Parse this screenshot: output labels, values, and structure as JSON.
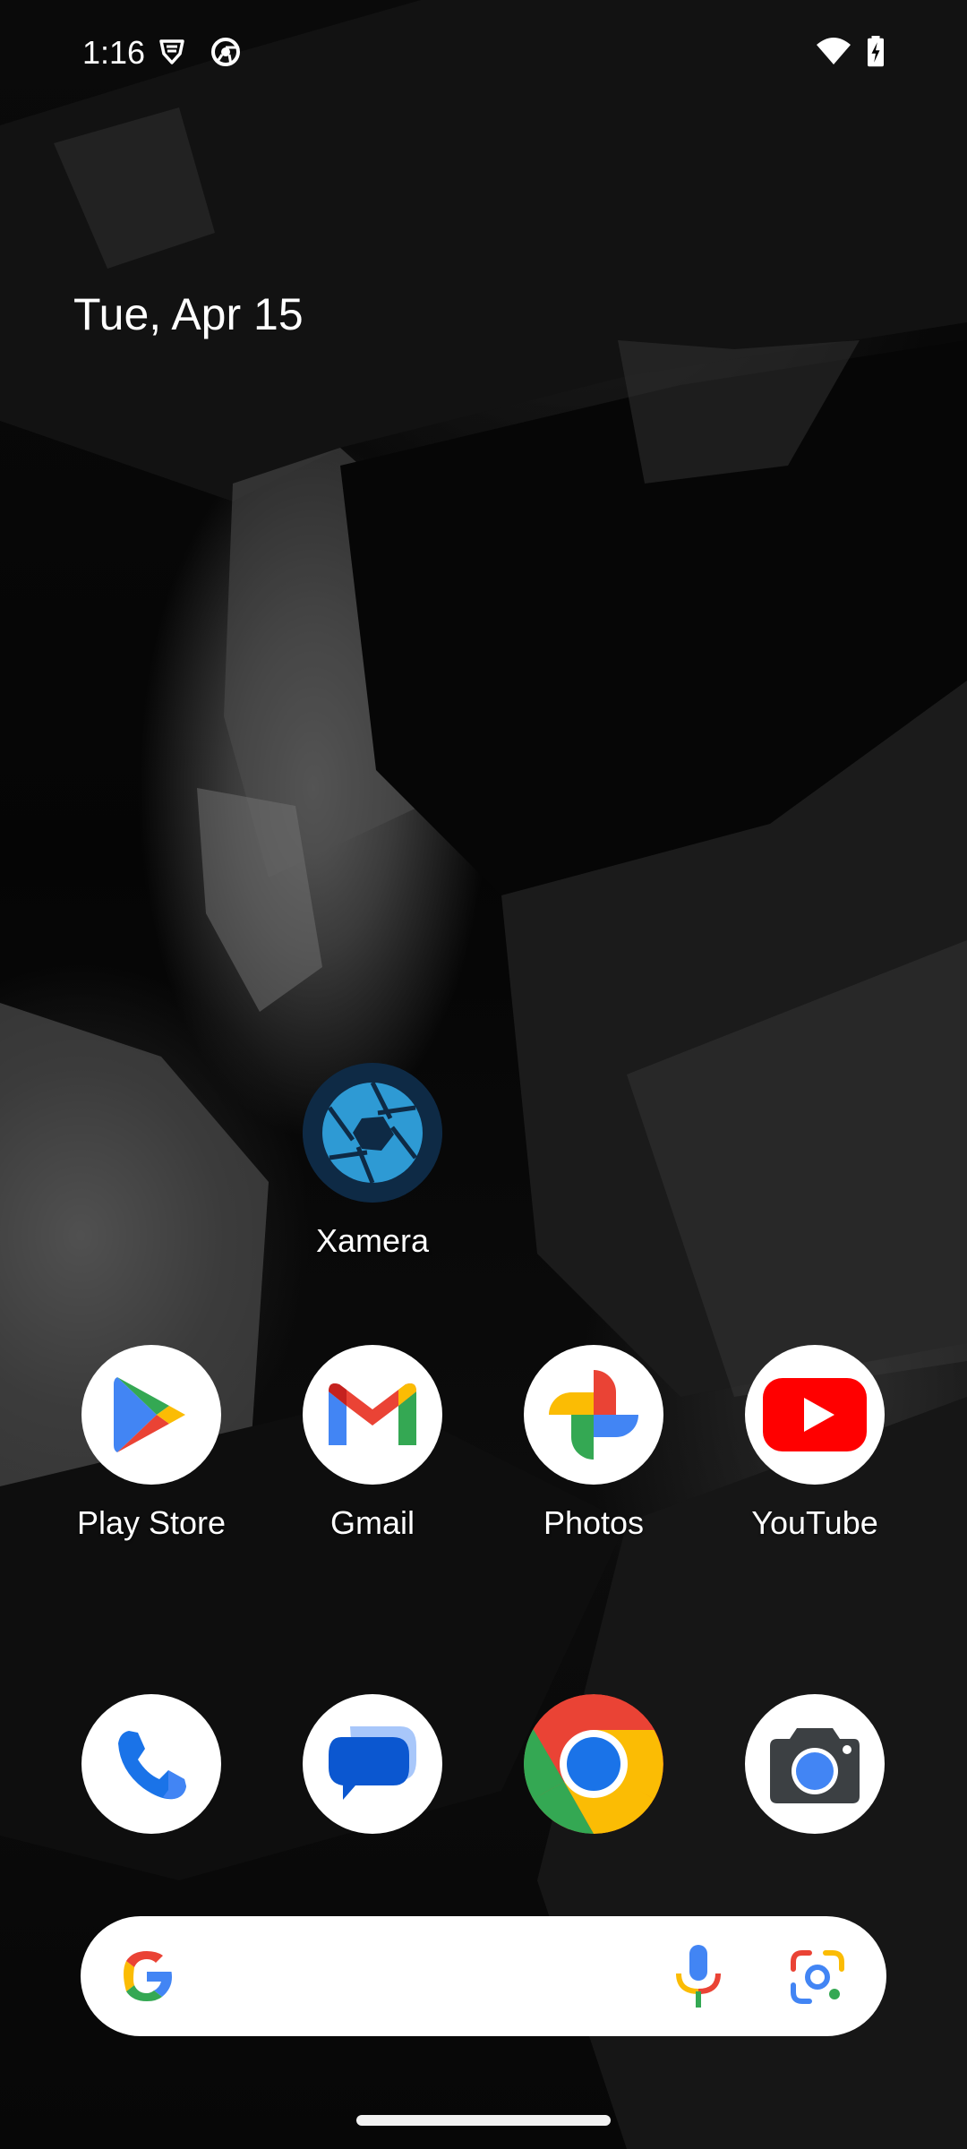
{
  "status_bar": {
    "time": "1:16",
    "icons": [
      "vpn-shield-icon",
      "chrome-notification-icon",
      "wifi-icon",
      "battery-charging-icon"
    ]
  },
  "date_widget": {
    "date": "Tue, Apr 15"
  },
  "home_apps": [
    {
      "label": "Xamera",
      "icon": "xamera-aperture-icon"
    }
  ],
  "app_row": [
    {
      "label": "Play Store",
      "icon": "play-store-icon"
    },
    {
      "label": "Gmail",
      "icon": "gmail-icon"
    },
    {
      "label": "Photos",
      "icon": "photos-icon"
    },
    {
      "label": "YouTube",
      "icon": "youtube-icon"
    }
  ],
  "dock": [
    {
      "name": "Phone",
      "icon": "phone-icon"
    },
    {
      "name": "Messages",
      "icon": "messages-icon"
    },
    {
      "name": "Chrome",
      "icon": "chrome-icon"
    },
    {
      "name": "Camera",
      "icon": "camera-icon"
    }
  ],
  "search_bar": {
    "icons": [
      "google-g-icon",
      "microphone-icon",
      "google-lens-icon"
    ]
  },
  "colors": {
    "google_blue": "#4285F4",
    "google_red": "#EA4335",
    "google_yellow": "#FBBC04",
    "google_green": "#34A853",
    "youtube_red": "#FF0000",
    "xamera_blue": "#2E9AD4",
    "xamera_bg": "#0E2A45"
  }
}
